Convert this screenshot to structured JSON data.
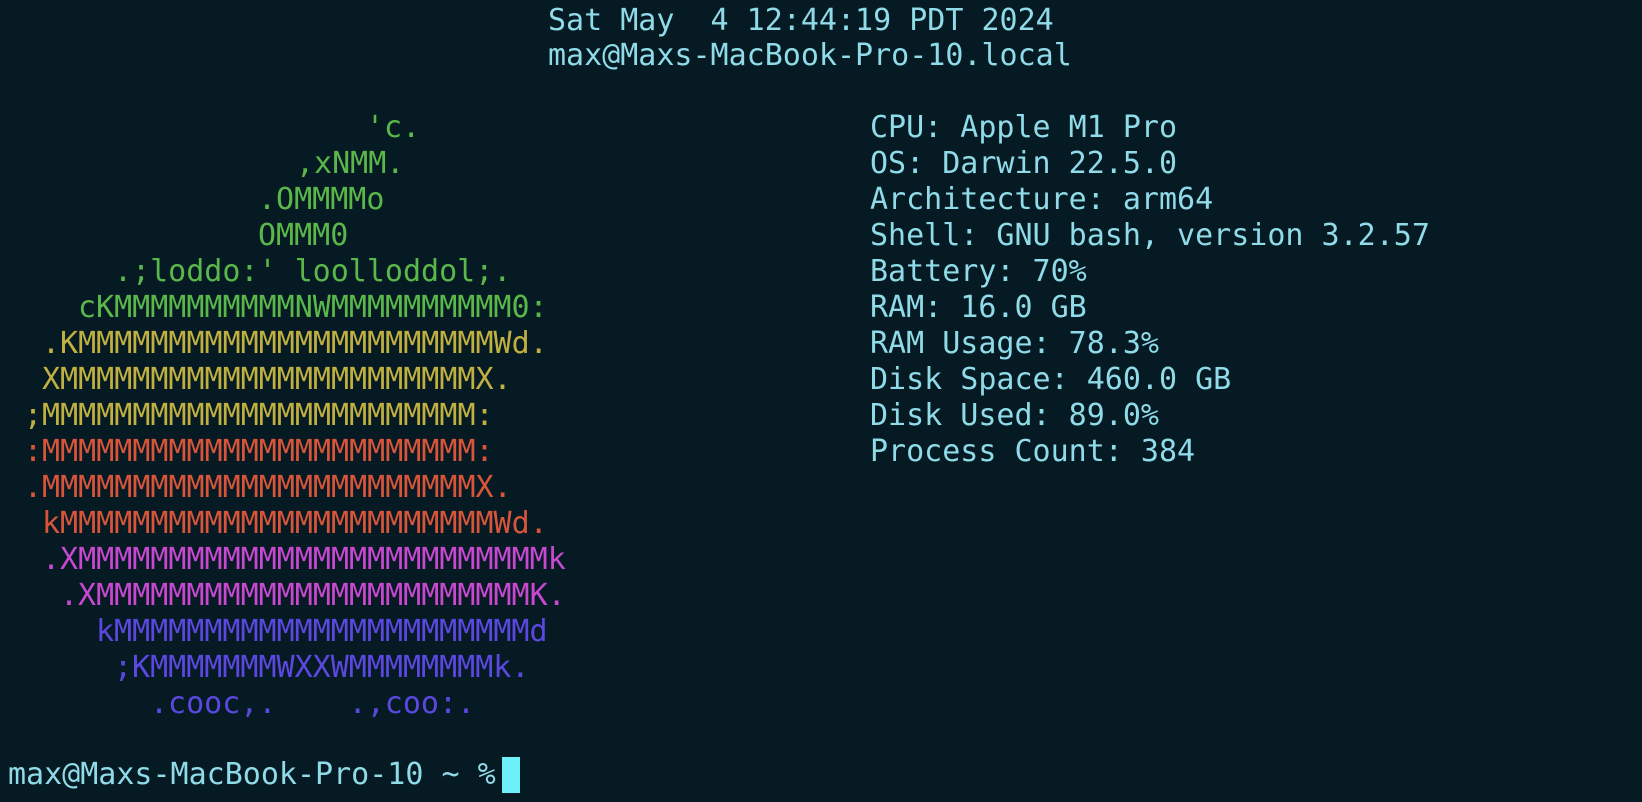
{
  "header": {
    "date": "Sat May  4 12:44:19 PDT 2024",
    "host": "max@Maxs-MacBook-Pro-10.local"
  },
  "logo": {
    "lines": [
      {
        "text": "'c.",
        "color": "#5ab84a"
      },
      {
        "text": ",xNMM.",
        "color": "#5ab84a"
      },
      {
        "text": ".OMMMMo",
        "color": "#5ab84a"
      },
      {
        "text": "OMMM0",
        "color": "#5ab84a"
      },
      {
        "text": ".;loddo:' loolloddol;.",
        "color": "#5ab84a"
      },
      {
        "text": "cKMMMMMMMMMMNWMMMMMMMMMM0:",
        "color": "#5ab84a"
      },
      {
        "text": ".KMMMMMMMMMMMMMMMMMMMMMMMWd.",
        "color": "#c0b040"
      },
      {
        "text": "XMMMMMMMMMMMMMMMMMMMMMMMX.",
        "color": "#c0b040"
      },
      {
        "text": ";MMMMMMMMMMMMMMMMMMMMMMMM:",
        "color": "#c0b040"
      },
      {
        "text": ":MMMMMMMMMMMMMMMMMMMMMMMM:",
        "color": "#d8553a"
      },
      {
        "text": ".MMMMMMMMMMMMMMMMMMMMMMMMX.",
        "color": "#d8553a"
      },
      {
        "text": "kMMMMMMMMMMMMMMMMMMMMMMMMWd.",
        "color": "#d8553a"
      },
      {
        "text": ".XMMMMMMMMMMMMMMMMMMMMMMMMMMk",
        "color": "#c848d0"
      },
      {
        "text": ".XMMMMMMMMMMMMMMMMMMMMMMMMK.",
        "color": "#c848d0"
      },
      {
        "text": "kMMMMMMMMMMMMMMMMMMMMMMMd",
        "color": "#5a48e0"
      },
      {
        "text": ";KMMMMMMMWXXWMMMMMMMMk.",
        "color": "#5a48e0"
      },
      {
        "text": ".cooc,.    .,coo:.",
        "color": "#5a48e0"
      }
    ]
  },
  "info": {
    "lines": [
      "CPU: Apple M1 Pro",
      "OS: Darwin 22.5.0",
      "Architecture: arm64",
      "Shell: GNU bash, version 3.2.57",
      "Battery: 70%",
      "RAM: 16.0 GB",
      "RAM Usage: 78.3%",
      "Disk Space: 460.0 GB",
      "Disk Used: 89.0%",
      "Process Count: 384"
    ]
  },
  "prompt": {
    "text": "max@Maxs-MacBook-Pro-10 ~ %"
  }
}
